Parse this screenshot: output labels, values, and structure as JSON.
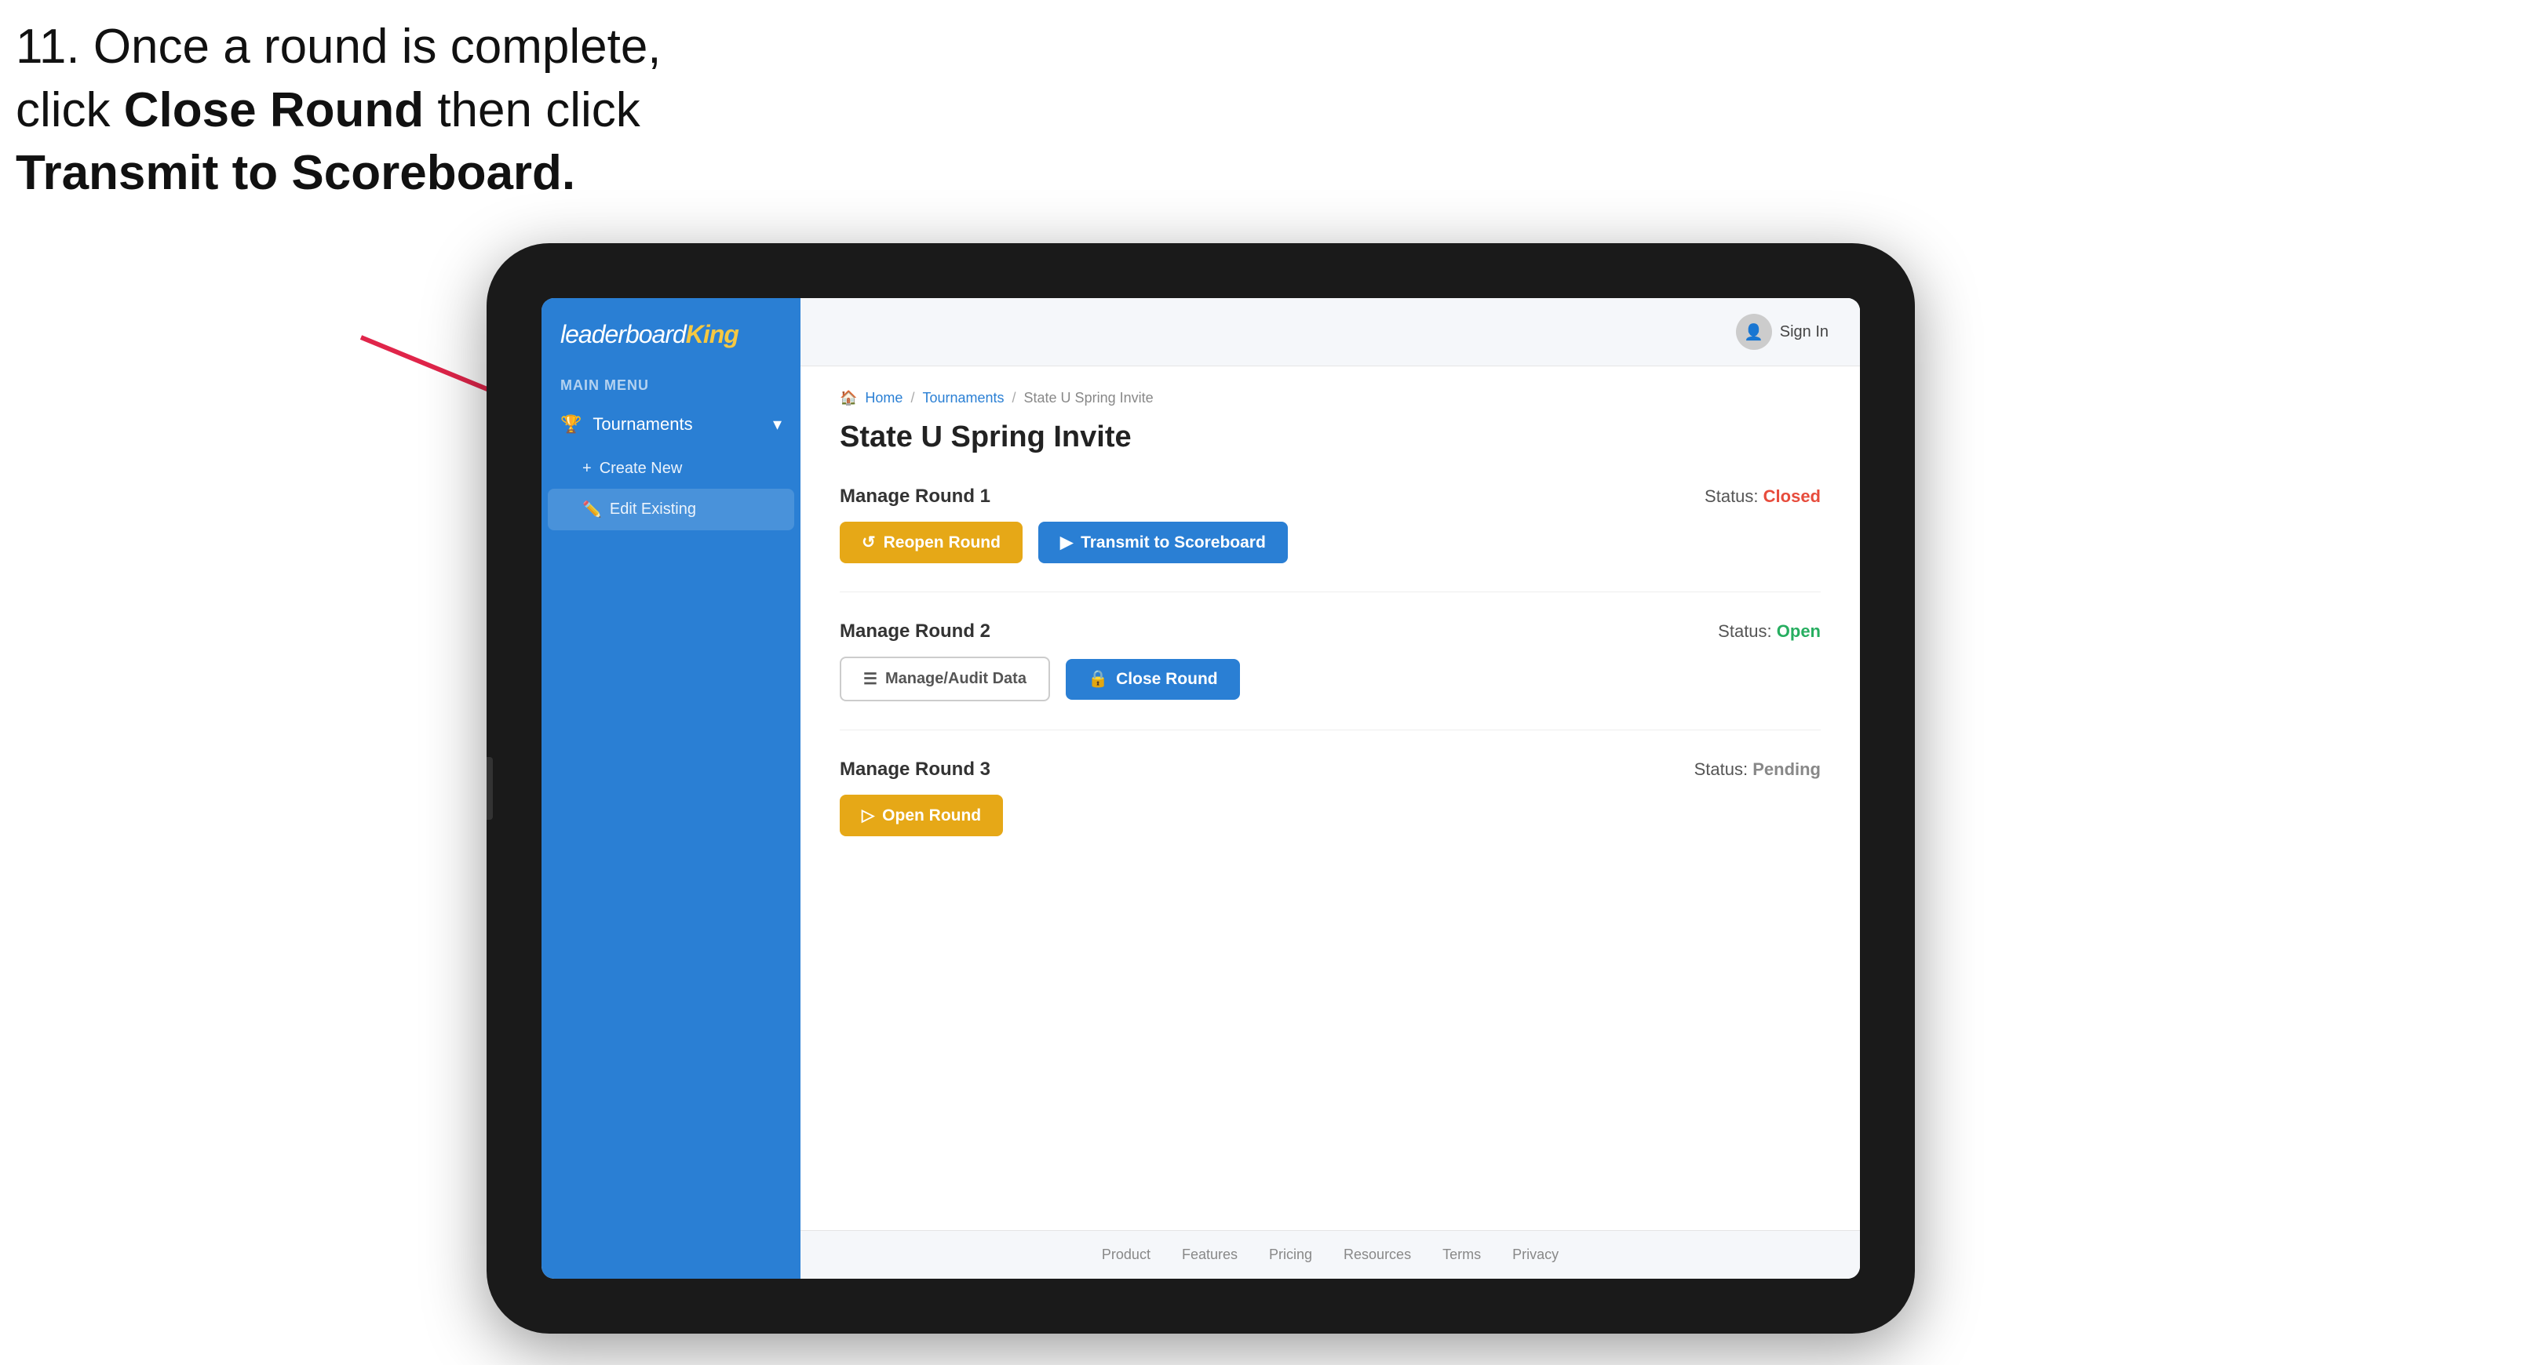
{
  "instruction": {
    "line1": "11. Once a round is complete,",
    "line2": "click ",
    "bold1": "Close Round",
    "line3": " then click",
    "bold2": "Transmit to Scoreboard."
  },
  "app": {
    "logo": {
      "text": "leaderboard",
      "king": "King"
    },
    "sidebar": {
      "main_menu_label": "MAIN MENU",
      "tournaments_label": "Tournaments",
      "create_new_label": "Create New",
      "edit_existing_label": "Edit Existing"
    },
    "topbar": {
      "sign_in": "Sign In"
    },
    "breadcrumb": {
      "home": "Home",
      "tournaments": "Tournaments",
      "current": "State U Spring Invite"
    },
    "page_title": "State U Spring Invite",
    "rounds": [
      {
        "id": "round1",
        "title": "Manage Round 1",
        "status_label": "Status:",
        "status_value": "Closed",
        "status_class": "status-closed",
        "buttons": [
          {
            "label": "Reopen Round",
            "style": "btn-yellow",
            "icon": "↺"
          },
          {
            "label": "Transmit to Scoreboard",
            "style": "btn-blue",
            "icon": "▶"
          }
        ]
      },
      {
        "id": "round2",
        "title": "Manage Round 2",
        "status_label": "Status:",
        "status_value": "Open",
        "status_class": "status-open",
        "buttons": [
          {
            "label": "Manage/Audit Data",
            "style": "btn-outline",
            "icon": "☰"
          },
          {
            "label": "Close Round",
            "style": "btn-blue",
            "icon": "🔒"
          }
        ]
      },
      {
        "id": "round3",
        "title": "Manage Round 3",
        "status_label": "Status:",
        "status_value": "Pending",
        "status_class": "status-pending",
        "buttons": [
          {
            "label": "Open Round",
            "style": "btn-yellow",
            "icon": "▷"
          }
        ]
      }
    ],
    "footer": {
      "links": [
        "Product",
        "Features",
        "Pricing",
        "Resources",
        "Terms",
        "Privacy"
      ]
    }
  }
}
